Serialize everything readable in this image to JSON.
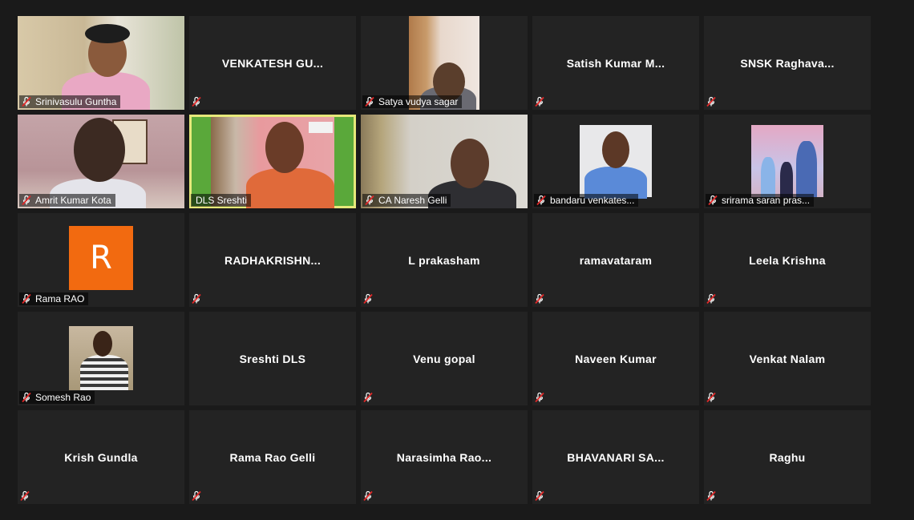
{
  "participants": [
    {
      "name": "Srinivasulu Guntha",
      "video": true
    },
    {
      "name": "VENKATESH GU...",
      "video": false
    },
    {
      "name": "Satya vudya sagar",
      "video": true
    },
    {
      "name": "Satish Kumar M...",
      "video": false
    },
    {
      "name": "SNSK Raghava...",
      "video": false
    },
    {
      "name": "Amrit Kumar Kota",
      "video": true
    },
    {
      "name": "DLS Sreshti",
      "video": true,
      "active_speaker": true
    },
    {
      "name": "CA Naresh Gelli",
      "video": true
    },
    {
      "name": "bandaru venkates...",
      "video": true
    },
    {
      "name": "srirama saran pras...",
      "video": true
    },
    {
      "name": "Rama RAO",
      "video": false,
      "avatar_letter": "R"
    },
    {
      "name": "RADHAKRISHN...",
      "video": false
    },
    {
      "name": "L prakasham",
      "video": false
    },
    {
      "name": "ramavataram",
      "video": false
    },
    {
      "name": "Leela Krishna",
      "video": false
    },
    {
      "name": "Somesh Rao",
      "video": true
    },
    {
      "name": "Sreshti DLS",
      "video": false
    },
    {
      "name": "Venu gopal",
      "video": false
    },
    {
      "name": "Naveen Kumar",
      "video": false
    },
    {
      "name": "Venkat Nalam",
      "video": false
    },
    {
      "name": "Krish Gundla",
      "video": false
    },
    {
      "name": "Rama Rao Gelli",
      "video": false
    },
    {
      "name": "Narasimha Rao...",
      "video": false
    },
    {
      "name": "BHAVANARI SA...",
      "video": false
    },
    {
      "name": "Raghu",
      "video": false
    }
  ],
  "colors": {
    "background": "#1a1a1a",
    "tile": "#232323",
    "active_border": "#e6e87a",
    "muted_icon": "#e02828",
    "avatar": "#f26a10"
  },
  "icons": {
    "muted": "mic-muted-icon"
  }
}
